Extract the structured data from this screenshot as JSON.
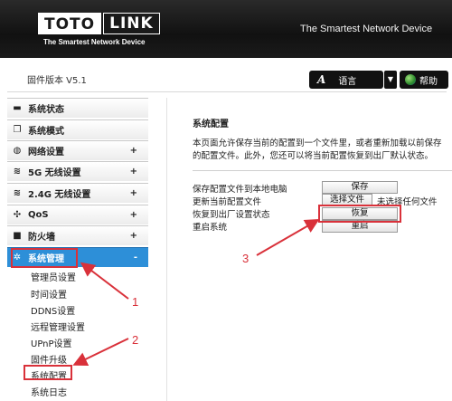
{
  "header": {
    "logo_left": "TOTO",
    "logo_right": "LINK",
    "logo_tagline": "The Smartest Network Device",
    "slogan": "The Smartest Network Device"
  },
  "toolbar": {
    "version": "固件版本 V5.1",
    "language_label": "语言",
    "help_label": "帮助"
  },
  "sidebar": {
    "items": [
      {
        "label": "系统状态",
        "icon": "chat-icon",
        "expandable": false
      },
      {
        "label": "系统模式",
        "icon": "window-icon",
        "expandable": false
      },
      {
        "label": "网络设置",
        "icon": "globe-icon",
        "expandable": true,
        "indicator": "+"
      },
      {
        "label": "5G 无线设置",
        "icon": "wifi-icon",
        "expandable": true,
        "indicator": "+"
      },
      {
        "label": "2.4G 无线设置",
        "icon": "wifi-icon",
        "expandable": true,
        "indicator": "+"
      },
      {
        "label": "QoS",
        "icon": "qos-icon",
        "expandable": true,
        "indicator": "+"
      },
      {
        "label": "防火墙",
        "icon": "lock-icon",
        "expandable": true,
        "indicator": "+"
      },
      {
        "label": "系统管理",
        "icon": "gear-icon",
        "expandable": true,
        "indicator": "-",
        "active": true
      }
    ],
    "subitems": [
      "管理员设置",
      "时间设置",
      "DDNS设置",
      "远程管理设置",
      "UPnP设置",
      "固件升级",
      "系统配置",
      "系统日志"
    ]
  },
  "content": {
    "title": "系统配置",
    "description": "本页面允许保存当前的配置到一个文件里，或者重新加载以前保存的配置文件。此外，您还可以将当前配置恢复到出厂默认状态。",
    "rows": [
      {
        "label": "保存配置文件到本地电脑",
        "button": "保存"
      },
      {
        "label": "更新当前配置文件",
        "button": "选择文件",
        "file_status": "未选择任何文件"
      },
      {
        "label": "恢复到出厂设置状态",
        "button": "恢复"
      },
      {
        "label": "重启系统",
        "button": "重启"
      }
    ]
  },
  "annotations": {
    "step1": "1",
    "step2": "2",
    "step3": "3",
    "color": "#d9313a"
  },
  "colors": {
    "header_bg": "#111111",
    "active_menu": "#2d8fd8",
    "annotation_red": "#d9313a"
  }
}
